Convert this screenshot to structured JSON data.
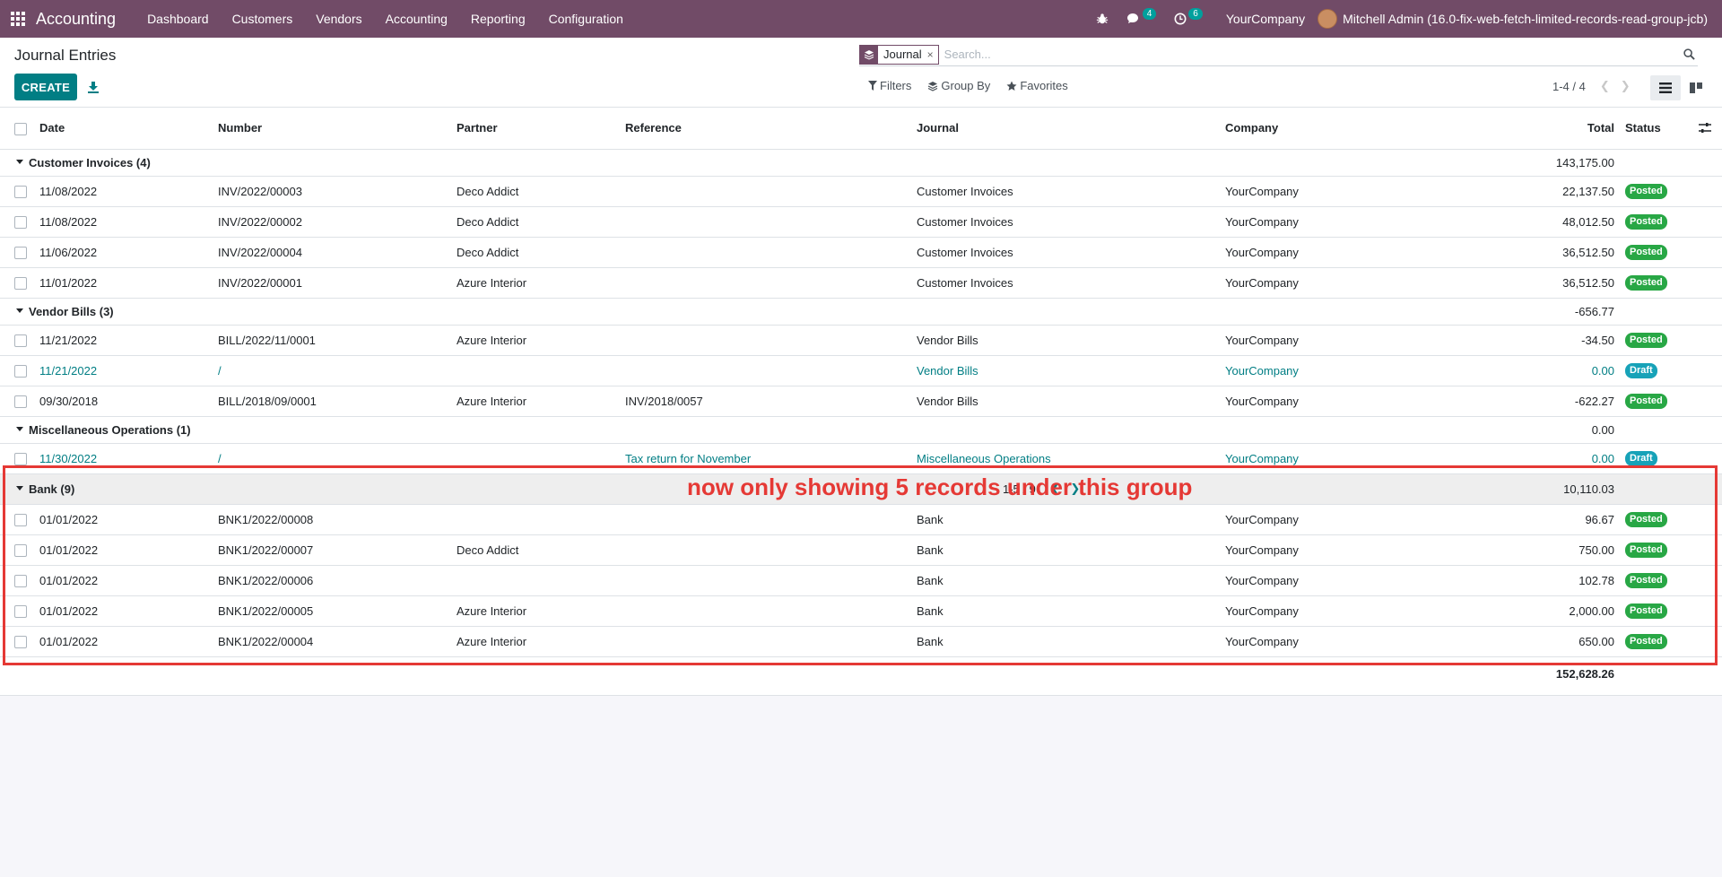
{
  "navbar": {
    "brand": "Accounting",
    "menu": [
      "Dashboard",
      "Customers",
      "Vendors",
      "Accounting",
      "Reporting",
      "Configuration"
    ],
    "messages_count": "4",
    "activities_count": "6",
    "company": "YourCompany",
    "user": "Mitchell Admin (16.0-fix-web-fetch-limited-records-read-group-jcb)"
  },
  "control_panel": {
    "title": "Journal Entries",
    "create_label": "CREATE",
    "facet_label": "Journal",
    "facet_close": "×",
    "search_placeholder": "Search...",
    "filters_label": "Filters",
    "groupby_label": "Group By",
    "favorites_label": "Favorites",
    "pager": "1-4 / 4"
  },
  "columns": [
    "Date",
    "Number",
    "Partner",
    "Reference",
    "Journal",
    "Company",
    "Total",
    "Status"
  ],
  "groups": [
    {
      "label": "Customer Invoices (4)",
      "total": "143,175.00",
      "rows": [
        {
          "date": "11/08/2022",
          "number": "INV/2022/00003",
          "partner": "Deco Addict",
          "reference": "",
          "journal": "Customer Invoices",
          "company": "YourCompany",
          "total": "22,137.50",
          "status": "Posted"
        },
        {
          "date": "11/08/2022",
          "number": "INV/2022/00002",
          "partner": "Deco Addict",
          "reference": "",
          "journal": "Customer Invoices",
          "company": "YourCompany",
          "total": "48,012.50",
          "status": "Posted"
        },
        {
          "date": "11/06/2022",
          "number": "INV/2022/00004",
          "partner": "Deco Addict",
          "reference": "",
          "journal": "Customer Invoices",
          "company": "YourCompany",
          "total": "36,512.50",
          "status": "Posted"
        },
        {
          "date": "11/01/2022",
          "number": "INV/2022/00001",
          "partner": "Azure Interior",
          "reference": "",
          "journal": "Customer Invoices",
          "company": "YourCompany",
          "total": "36,512.50",
          "status": "Posted"
        }
      ]
    },
    {
      "label": "Vendor Bills (3)",
      "total": "-656.77",
      "rows": [
        {
          "date": "11/21/2022",
          "number": "BILL/2022/11/0001",
          "partner": "Azure Interior",
          "reference": "",
          "journal": "Vendor Bills",
          "company": "YourCompany",
          "total": "-34.50",
          "status": "Posted"
        },
        {
          "date": "11/21/2022",
          "number": "/",
          "partner": "",
          "reference": "",
          "journal": "Vendor Bills",
          "company": "YourCompany",
          "total": "0.00",
          "status": "Draft"
        },
        {
          "date": "09/30/2018",
          "number": "BILL/2018/09/0001",
          "partner": "Azure Interior",
          "reference": "INV/2018/0057",
          "journal": "Vendor Bills",
          "company": "YourCompany",
          "total": "-622.27",
          "status": "Posted"
        }
      ]
    },
    {
      "label": "Miscellaneous Operations (1)",
      "total": "0.00",
      "rows": [
        {
          "date": "11/30/2022",
          "number": "/",
          "partner": "",
          "reference": "Tax return for November",
          "journal": "Miscellaneous Operations",
          "company": "YourCompany",
          "total": "0.00",
          "status": "Draft"
        }
      ]
    },
    {
      "label": "Bank (9)",
      "total": "10,110.03",
      "pager": "1-5 / 9",
      "rows": [
        {
          "date": "01/01/2022",
          "number": "BNK1/2022/00008",
          "partner": "",
          "reference": "",
          "journal": "Bank",
          "company": "YourCompany",
          "total": "96.67",
          "status": "Posted"
        },
        {
          "date": "01/01/2022",
          "number": "BNK1/2022/00007",
          "partner": "Deco Addict",
          "reference": "",
          "journal": "Bank",
          "company": "YourCompany",
          "total": "750.00",
          "status": "Posted"
        },
        {
          "date": "01/01/2022",
          "number": "BNK1/2022/00006",
          "partner": "",
          "reference": "",
          "journal": "Bank",
          "company": "YourCompany",
          "total": "102.78",
          "status": "Posted"
        },
        {
          "date": "01/01/2022",
          "number": "BNK1/2022/00005",
          "partner": "Azure Interior",
          "reference": "",
          "journal": "Bank",
          "company": "YourCompany",
          "total": "2,000.00",
          "status": "Posted"
        },
        {
          "date": "01/01/2022",
          "number": "BNK1/2022/00004",
          "partner": "Azure Interior",
          "reference": "",
          "journal": "Bank",
          "company": "YourCompany",
          "total": "650.00",
          "status": "Posted"
        }
      ]
    }
  ],
  "grand_total": "152,628.26",
  "annotation": "now only showing 5 records under this group",
  "colors": {
    "navbar": "#714b67",
    "primary": "#017e84",
    "posted": "#28a745",
    "draft": "#17a2b8",
    "annotation": "#e53935"
  },
  "icons": {
    "apps": "apps-grid-icon",
    "debug": "bug-icon",
    "messages": "chat-icon",
    "activities": "clock-icon",
    "search": "search-icon",
    "list_view": "list-view-icon",
    "kanban_view": "kanban-view-icon"
  }
}
